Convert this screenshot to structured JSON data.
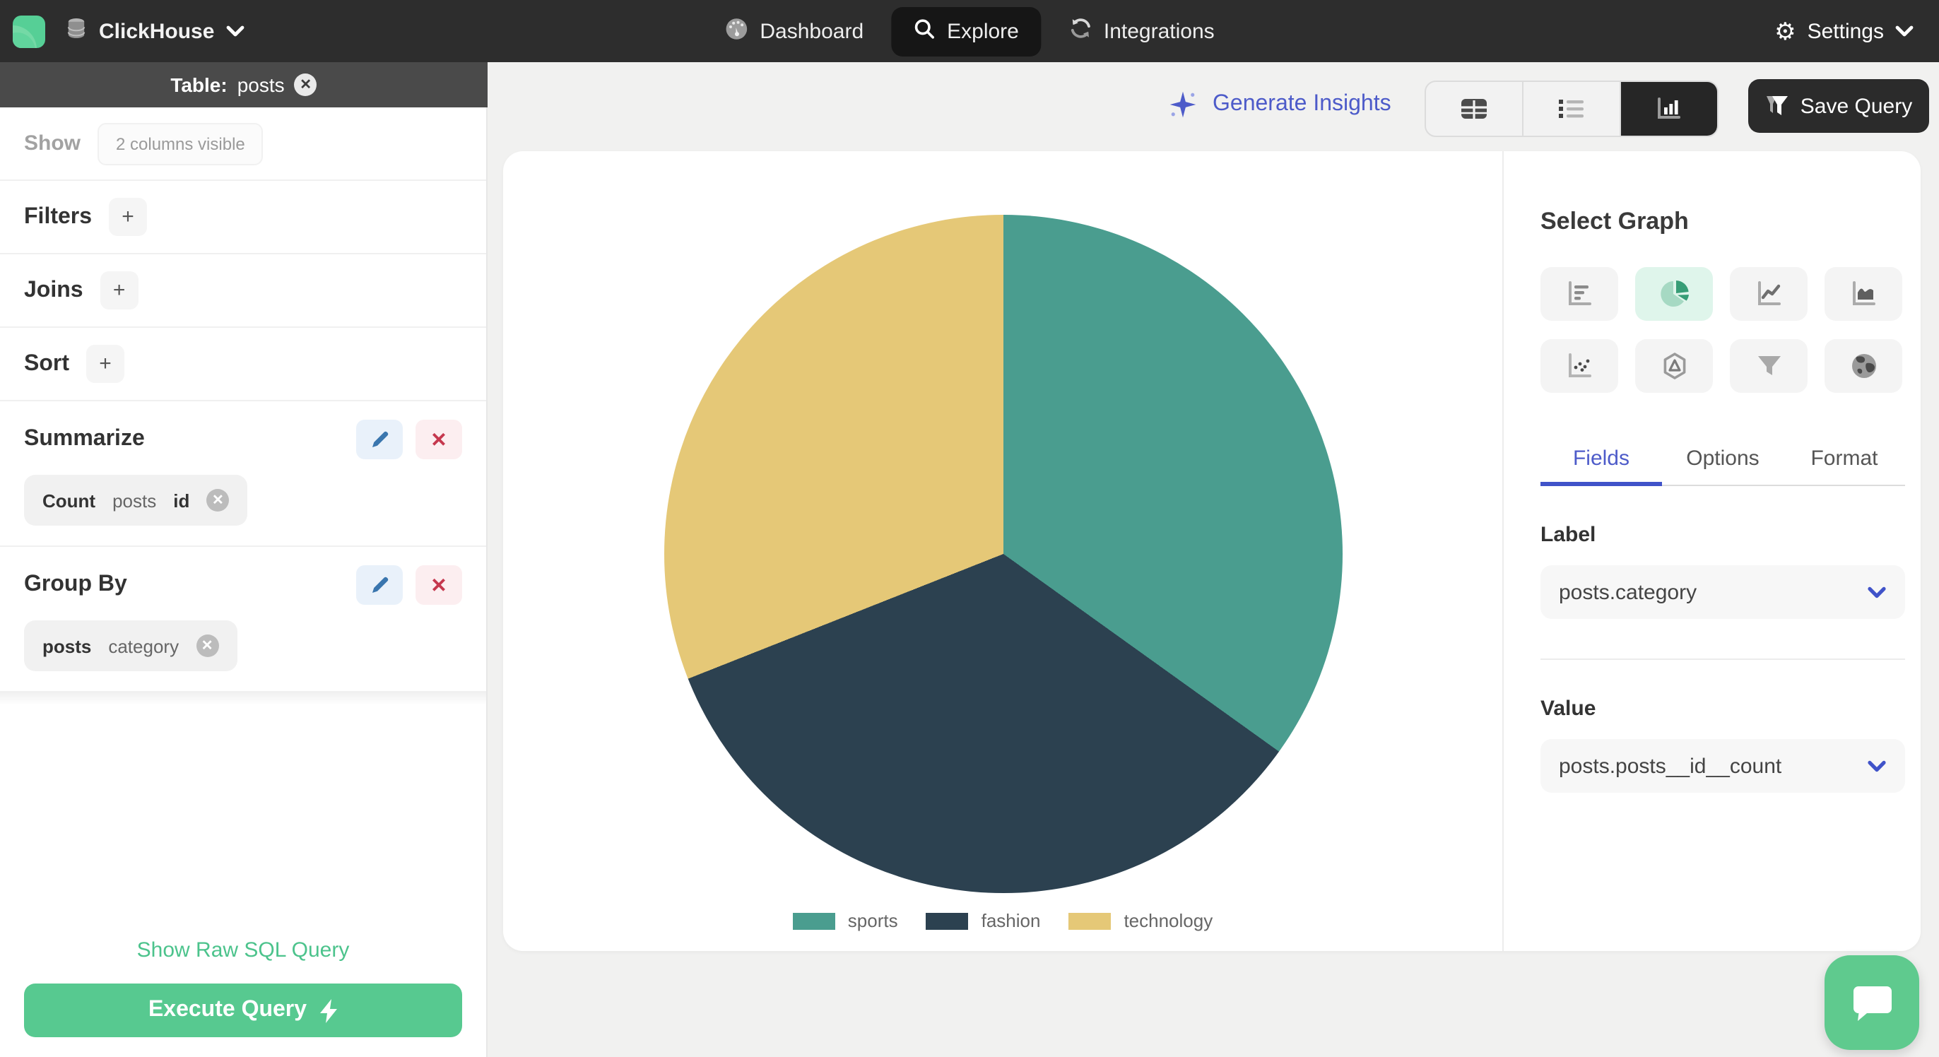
{
  "nav": {
    "brand": "ClickHouse",
    "items": [
      {
        "label": "Dashboard"
      },
      {
        "label": "Explore",
        "active": true
      },
      {
        "label": "Integrations"
      }
    ],
    "settings_label": "Settings"
  },
  "sidebar": {
    "table_bar": {
      "prefix": "Table:",
      "table_name": "posts"
    },
    "show": {
      "label": "Show",
      "badge": "2 columns visible"
    },
    "filters_label": "Filters",
    "joins_label": "Joins",
    "sort_label": "Sort",
    "add_label": "+",
    "summarize": {
      "title": "Summarize",
      "chip": {
        "agg": "Count",
        "table": "posts",
        "field": "id"
      }
    },
    "group_by": {
      "title": "Group By",
      "chip": {
        "table": "posts",
        "field": "category"
      }
    },
    "raw_sql_label": "Show Raw SQL Query",
    "execute_label": "Execute Query"
  },
  "toolbar": {
    "generate_insights_label": "Generate Insights",
    "save_query_label": "Save Query"
  },
  "graph_panel": {
    "title": "Select Graph",
    "graph_types": [
      "bar-chart",
      "pie-chart",
      "line-chart",
      "area-chart",
      "scatter-plot",
      "radar-chart",
      "funnel-chart",
      "map-chart"
    ],
    "active_graph": "pie-chart",
    "tabs": {
      "fields": "Fields",
      "options": "Options",
      "format": "Format"
    },
    "label_section": {
      "title": "Label",
      "value": "posts.category"
    },
    "value_section": {
      "title": "Value",
      "value": "posts.posts__id__count"
    }
  },
  "chart_data": {
    "type": "pie",
    "categories": [
      "sports",
      "fashion",
      "technology"
    ],
    "values": [
      34.9,
      34.1,
      31.0
    ],
    "colors": [
      "#4A9D8F",
      "#2C4150",
      "#E5C877"
    ],
    "legend_position": "bottom",
    "start_angle_deg": 0
  },
  "colors": {
    "accent_green": "#57c990",
    "accent_indigo": "#4d5bc9",
    "nav_bg": "#2d2d2d",
    "active_graph_bg": "#dff5eb"
  }
}
